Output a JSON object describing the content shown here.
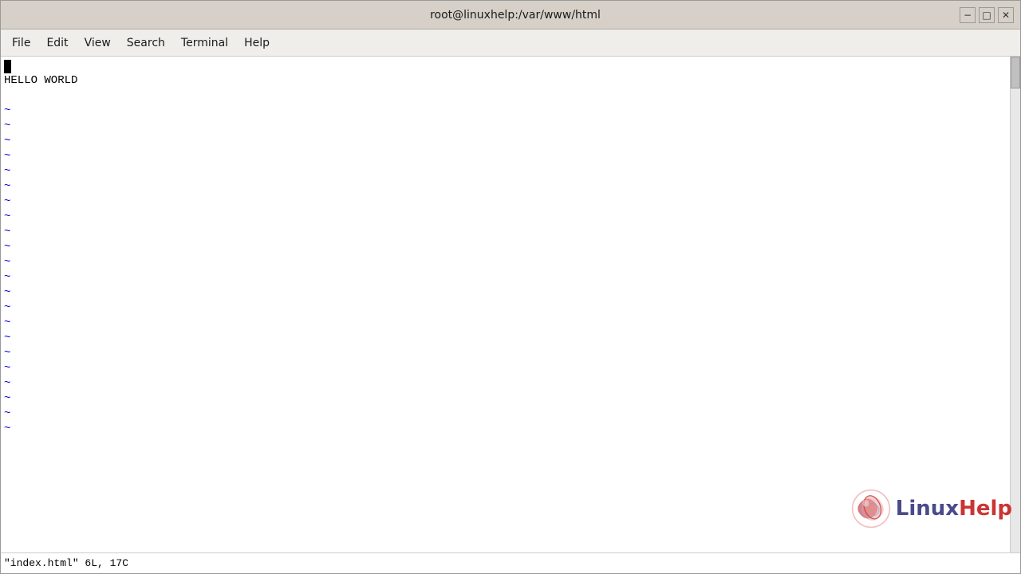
{
  "window": {
    "title": "root@linuxhelp:/var/www/html",
    "minimize_label": "−",
    "maximize_label": "□",
    "close_label": "✕"
  },
  "menu": {
    "items": [
      {
        "label": "File"
      },
      {
        "label": "Edit"
      },
      {
        "label": "View"
      },
      {
        "label": "Search"
      },
      {
        "label": "Terminal"
      },
      {
        "label": "Help"
      }
    ]
  },
  "editor": {
    "cursor_line": "",
    "content_line": "HELLO WORLD",
    "tilde_count": 22
  },
  "status_bar": {
    "text": "\"index.html\" 6L, 17C"
  },
  "watermark": {
    "linux_text": "Linux",
    "help_text": "Help"
  }
}
